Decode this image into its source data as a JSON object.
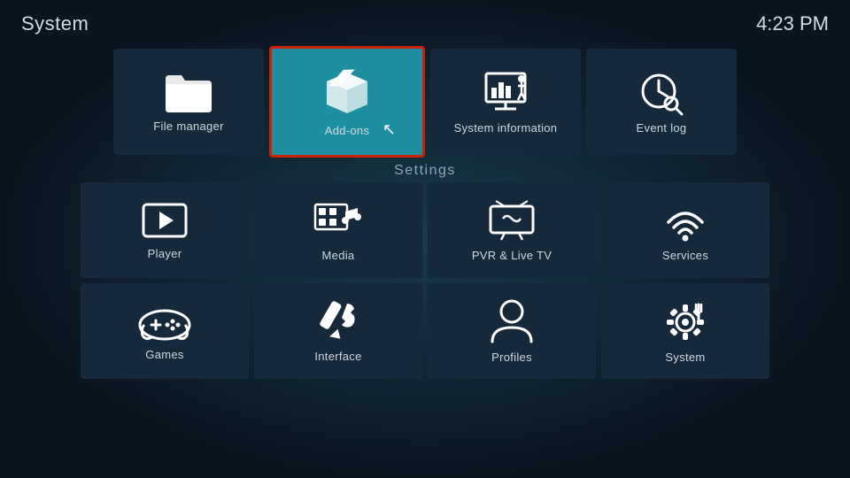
{
  "header": {
    "title": "System",
    "time": "4:23 PM"
  },
  "top_row": [
    {
      "id": "file-manager",
      "label": "File manager",
      "icon": "folder"
    },
    {
      "id": "add-ons",
      "label": "Add-ons",
      "icon": "box",
      "selected": true
    },
    {
      "id": "system-information",
      "label": "System information",
      "icon": "chart"
    },
    {
      "id": "event-log",
      "label": "Event log",
      "icon": "clock-search"
    }
  ],
  "settings_label": "Settings",
  "settings_row1": [
    {
      "id": "player",
      "label": "Player",
      "icon": "play"
    },
    {
      "id": "media",
      "label": "Media",
      "icon": "media"
    },
    {
      "id": "pvr-live-tv",
      "label": "PVR & Live TV",
      "icon": "tv"
    },
    {
      "id": "services",
      "label": "Services",
      "icon": "wifi"
    }
  ],
  "settings_row2": [
    {
      "id": "games",
      "label": "Games",
      "icon": "gamepad"
    },
    {
      "id": "interface",
      "label": "Interface",
      "icon": "pencil"
    },
    {
      "id": "profiles",
      "label": "Profiles",
      "icon": "person"
    },
    {
      "id": "system",
      "label": "System",
      "icon": "gear"
    }
  ]
}
